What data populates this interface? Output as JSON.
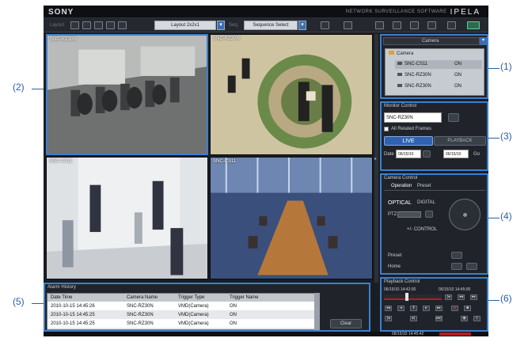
{
  "brand": "SONY",
  "product": "NETWORK SURVEILLANCE SOFTWARE",
  "product_logo": "IPELA",
  "toolbar": {
    "layout_label": "Layout",
    "layout_select": "Layout 2x2x1",
    "sequence_label": "Seq.",
    "sequence_select": "Sequence Select"
  },
  "videos": [
    {
      "camera": "SNC-RZ30N"
    },
    {
      "camera": "SNC-RZ30N"
    },
    {
      "camera": "SNC-CS11"
    },
    {
      "camera": "SNC-CS11"
    }
  ],
  "camera_panel": {
    "title": "Camera",
    "tree": [
      {
        "label": "Camera",
        "type": "folder",
        "status": ""
      },
      {
        "label": "SNC-CS11",
        "type": "cam",
        "status": "ON"
      },
      {
        "label": "SNC-RZ30N",
        "type": "cam",
        "status": "ON"
      },
      {
        "label": "SNC-RZ30N",
        "type": "cam",
        "status": "ON"
      }
    ]
  },
  "monitor": {
    "title": "Monitor Control",
    "camera_value": "SNC-RZ30N",
    "all_frames": "All Related Frames",
    "live": "LIVE",
    "playback": "PLAYBACK",
    "date_label": "Date",
    "date1": "06/15/10",
    "date2": "06/15/10",
    "go": "Go"
  },
  "camera_control": {
    "title": "Camera Control",
    "tab1": "Operation",
    "tab2": "Preset",
    "optical": "OPTICAL",
    "digital": "DIGITAL",
    "ptz_label": "PTZ",
    "adjust": "+/- CONTROL",
    "preset": "Preset",
    "home": "Home"
  },
  "alarm": {
    "title": "Alarm History",
    "columns": [
      "Date Time",
      "Camera Name",
      "Trigger Type",
      "Trigger Name"
    ],
    "rows": [
      [
        "2010-10-15 14:45:26",
        "SNC-RZ30N",
        "VMD(Camera)",
        "ON"
      ],
      [
        "2010-10-15 14:45:25",
        "SNC-RZ30N",
        "VMD(Camera)",
        "ON"
      ],
      [
        "2010-10-15 14:45:25",
        "SNC-RZ30N",
        "VMD(Camera)",
        "ON"
      ]
    ],
    "clear": "Clear"
  },
  "playback": {
    "title": "Playback Control",
    "start_time": "06/15/10 14:42:00",
    "end_time": "06/15/10 14:45:00",
    "status_time": "06/15/10 14:45:42"
  },
  "callouts": [
    "(1)",
    "(2)",
    "(3)",
    "(4)",
    "(5)",
    "(6)"
  ],
  "colors": {
    "accent": "#3b7fd1",
    "callout": "#2a5da8",
    "live": "#2f63b0",
    "bg": "#1a1d22"
  }
}
